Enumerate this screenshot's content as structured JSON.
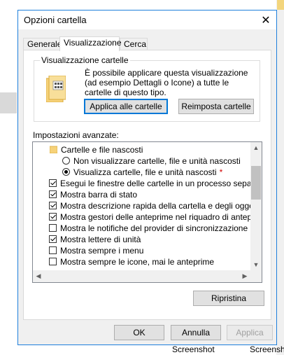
{
  "window": {
    "title": "Opzioni cartella"
  },
  "tabs": [
    {
      "label": "Generale"
    },
    {
      "label": "Visualizzazione"
    },
    {
      "label": "Cerca"
    }
  ],
  "view_group": {
    "title": "Visualizzazione cartelle",
    "description": "È possibile applicare questa visualizzazione (ad esempio Dettagli o Icone) a tutte le cartelle di questo tipo.",
    "apply_button": "Applica alle cartelle",
    "reset_button": "Reimposta cartelle"
  },
  "advanced": {
    "label": "Impostazioni avanzate:",
    "items": [
      {
        "type": "folder",
        "label": "Cartelle e file nascosti",
        "indent": 0
      },
      {
        "type": "radio",
        "label": "Non visualizzare cartelle, file e unità nascosti",
        "checked": false,
        "indent": 1
      },
      {
        "type": "radio",
        "label": "Visualizza cartelle, file e unità nascosti",
        "checked": true,
        "indent": 1,
        "marker": "*"
      },
      {
        "type": "check",
        "label": "Esegui le finestre delle cartelle in un processo separato",
        "checked": true,
        "indent": 0
      },
      {
        "type": "check",
        "label": "Mostra barra di stato",
        "checked": true,
        "indent": 0
      },
      {
        "type": "check",
        "label": "Mostra descrizione rapida della cartella e degli oggetti del",
        "checked": true,
        "indent": 0
      },
      {
        "type": "check",
        "label": "Mostra gestori delle anteprime nel riquadro di anteprima",
        "checked": true,
        "indent": 0
      },
      {
        "type": "check",
        "label": "Mostra le notifiche del provider di sincronizzazione",
        "checked": false,
        "indent": 0
      },
      {
        "type": "check",
        "label": "Mostra lettere di unità",
        "checked": true,
        "indent": 0
      },
      {
        "type": "check",
        "label": "Mostra sempre i menu",
        "checked": false,
        "indent": 0
      },
      {
        "type": "check",
        "label": "Mostra sempre le icone, mai le anteprime",
        "checked": false,
        "indent": 0
      }
    ]
  },
  "restore_button": "Ripristina",
  "footer": {
    "ok": "OK",
    "cancel": "Annulla",
    "apply": "Applica"
  },
  "background": {
    "captions": [
      "Screenshot",
      "Screenshot"
    ]
  }
}
